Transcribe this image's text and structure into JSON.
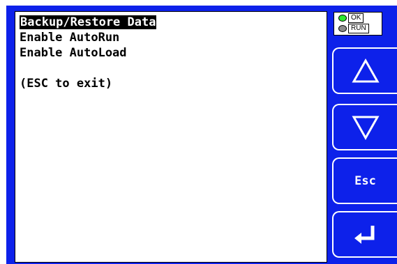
{
  "menu": {
    "items": [
      {
        "label": "Backup/Restore Data",
        "selected": true
      },
      {
        "label": "Enable AutoRun",
        "selected": false
      },
      {
        "label": "Enable AutoLoad",
        "selected": false
      }
    ],
    "hint": "(ESC to exit)"
  },
  "status": {
    "ok_label": "OK",
    "run_label": "RUN",
    "ok_led_color": "#2ee82e",
    "run_led_color": "#8a8a8a"
  },
  "keys": {
    "up_icon": "triangle-up",
    "down_icon": "triangle-down",
    "esc_label": "Esc",
    "enter_icon": "enter-arrow"
  },
  "colors": {
    "frame_blue": "#0d21ea",
    "screen_bg": "#ffffff"
  }
}
